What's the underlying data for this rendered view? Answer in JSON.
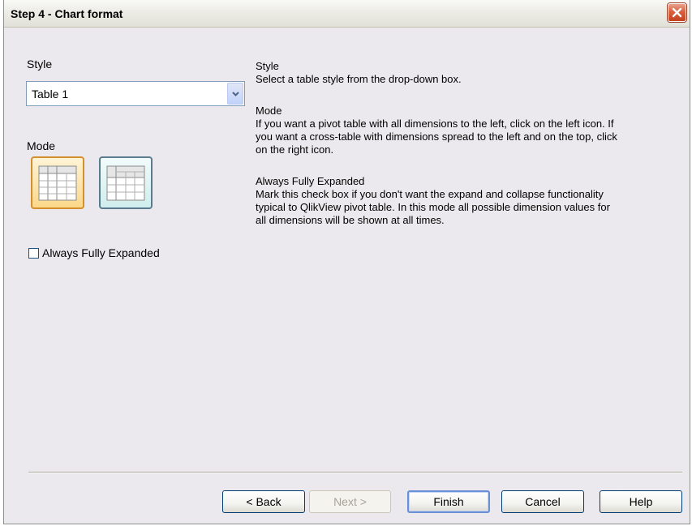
{
  "window": {
    "title": "Step 4 - Chart format"
  },
  "left": {
    "style_label": "Style",
    "style_select": {
      "value": "Table 1"
    },
    "mode_label": "Mode",
    "mode_options": [
      {
        "name": "pivot-left",
        "selected": true
      },
      {
        "name": "cross-table",
        "selected": false
      }
    ],
    "always_expanded": {
      "label": "Always Fully Expanded",
      "checked": false
    }
  },
  "help": {
    "style_heading": "Style",
    "style_text": "Select a table style from the drop-down box.",
    "mode_heading": "Mode",
    "mode_text_1": "If you want a pivot table with all dimensions to the left, click on the left icon. If",
    "mode_text_2": "you want a cross-table with dimensions spread to the left and on the top, click",
    "mode_text_3": "on the right icon.",
    "expand_heading": "Always Fully Expanded",
    "expand_text_1": "Mark this check box if you don't want the expand and collapse functionality",
    "expand_text_2": "typical to QlikView pivot table. In this mode all possible dimension values for",
    "expand_text_3": "all dimensions will be shown at all times."
  },
  "buttons": {
    "back": "< Back",
    "next": "Next >",
    "finish": "Finish",
    "cancel": "Cancel",
    "help": "Help"
  }
}
